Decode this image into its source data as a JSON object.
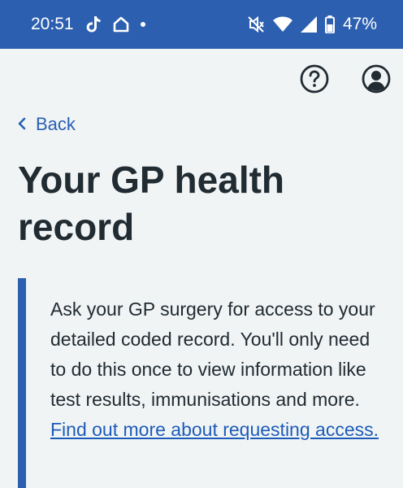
{
  "status_bar": {
    "time": "20:51",
    "battery": "47%",
    "icons": [
      "tiktok-icon",
      "home-icon",
      "notification-dot-icon",
      "mute-icon",
      "wifi-icon",
      "signal-icon",
      "battery-icon"
    ]
  },
  "header": {
    "help_icon": "help-icon",
    "account_icon": "account-icon"
  },
  "nav": {
    "back_label": "Back"
  },
  "page": {
    "title": "Your GP health record",
    "callout_text": "Ask your GP surgery for access to your detailed coded record. You'll only need to do this once to view information like test results, immunisations and more.",
    "callout_link": "Find out more about requesting access."
  },
  "colors": {
    "status_bar": "#2c5fb0",
    "background": "#f0f4f5",
    "link": "#1d5bb8",
    "text": "#212b32",
    "callout_border": "#2c5fb0"
  }
}
